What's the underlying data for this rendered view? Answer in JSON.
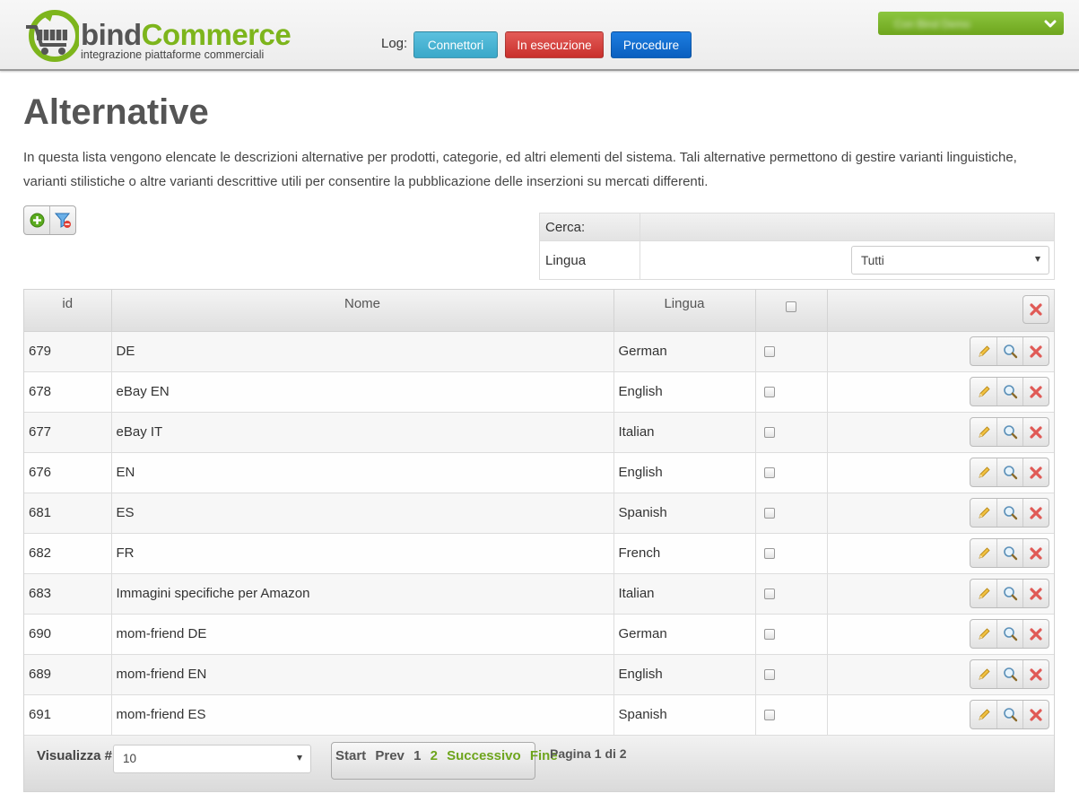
{
  "header": {
    "brand_part1": "bind",
    "brand_part2": "Commerce",
    "tagline": "integrazione piattaforme commerciali",
    "log_label": "Log:",
    "buttons": {
      "connettori": "Connettori",
      "in_esecuzione": "In esecuzione",
      "procedure": "Procedure"
    },
    "user_menu": {
      "name": "Con Bind Demo"
    }
  },
  "page": {
    "title": "Alternative",
    "description": "In questa lista vengono elencate le descrizioni alternative per prodotti, categorie, ed altri elementi del sistema. Tali alternative permettono di gestire varianti linguistiche, varianti stilistiche o altre varianti descrittive utili per consentire la pubblicazione delle inserzioni su mercati differenti."
  },
  "search": {
    "title": "Cerca:",
    "lingua_label": "Lingua",
    "lingua_value": "Tutti"
  },
  "table": {
    "columns": {
      "id": "id",
      "nome": "Nome",
      "lingua": "Lingua"
    },
    "rows": [
      {
        "id": "679",
        "nome": "DE",
        "lingua": "German"
      },
      {
        "id": "678",
        "nome": "eBay EN",
        "lingua": "English"
      },
      {
        "id": "677",
        "nome": "eBay IT",
        "lingua": "Italian"
      },
      {
        "id": "676",
        "nome": "EN",
        "lingua": "English"
      },
      {
        "id": "681",
        "nome": "ES",
        "lingua": "Spanish"
      },
      {
        "id": "682",
        "nome": "FR",
        "lingua": "French"
      },
      {
        "id": "683",
        "nome": "Immagini specifiche per Amazon",
        "lingua": "Italian"
      },
      {
        "id": "690",
        "nome": "mom-friend DE",
        "lingua": "German"
      },
      {
        "id": "689",
        "nome": "mom-friend EN",
        "lingua": "English"
      },
      {
        "id": "691",
        "nome": "mom-friend ES",
        "lingua": "Spanish"
      }
    ]
  },
  "footer": {
    "visualizza_label": "Visualizza #",
    "page_size": "10",
    "pager": {
      "start": "Start",
      "prev": "Prev",
      "page1": "1",
      "page2": "2",
      "next": "Successivo",
      "end": "Fine"
    },
    "page_info": "Pagina 1 di 2"
  },
  "colors": {
    "accent_green": "#7db51c",
    "info_blue": "#5bc0de",
    "danger_red": "#d9534f",
    "primary_blue": "#0a6fd6"
  },
  "icons": {
    "add": "add-circle-icon",
    "filter_remove": "filter-remove-icon",
    "edit": "pencil-icon",
    "view": "magnifier-icon",
    "delete": "delete-x-icon",
    "menu_chevron": "chevron-down-icon"
  }
}
